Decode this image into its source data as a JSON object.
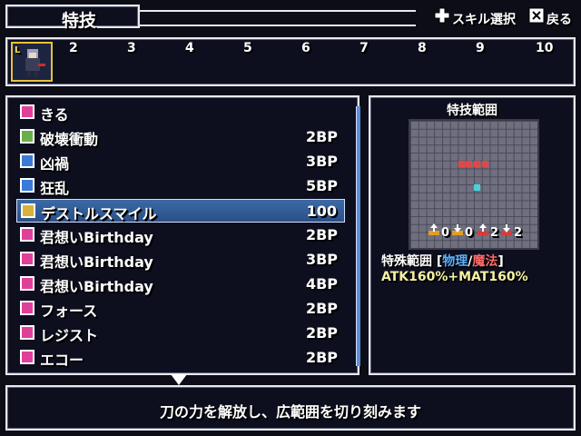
{
  "header": {
    "title": "特技",
    "hint_skill": "スキル選択",
    "hint_back": "戻る"
  },
  "party": {
    "slots": [
      "2",
      "3",
      "4",
      "5",
      "6",
      "7",
      "8",
      "9",
      "10"
    ],
    "leader_mark": "L"
  },
  "skills": [
    {
      "name": "きる",
      "cost": "",
      "icon": "pink-sword-icon",
      "color": "#e0409a"
    },
    {
      "name": "破壊衝動",
      "cost": "2BP",
      "icon": "green-plus-icon",
      "color": "#6ab04a"
    },
    {
      "name": "凶禍",
      "cost": "3BP",
      "icon": "square-icon",
      "color": "#3a7ad8"
    },
    {
      "name": "狂乱",
      "cost": "5BP",
      "icon": "square-icon",
      "color": "#3a7ad8"
    },
    {
      "name": "デストルスマイル",
      "cost": "100",
      "icon": "yellow-gear-icon",
      "color": "#d6b23a",
      "selected": true
    },
    {
      "name": "君想いBirthday",
      "cost": "2BP",
      "icon": "music-note-icon",
      "color": "#e0409a"
    },
    {
      "name": "君想いBirthday",
      "cost": "3BP",
      "icon": "music-note-plus-icon",
      "color": "#e0409a"
    },
    {
      "name": "君想いBirthday",
      "cost": "4BP",
      "icon": "music-note-plus2-icon",
      "color": "#e0409a"
    },
    {
      "name": "フォース",
      "cost": "2BP",
      "icon": "vo-icon",
      "color": "#e0409a"
    },
    {
      "name": "レジスト",
      "cost": "2BP",
      "icon": "vo-icon",
      "color": "#e0409a"
    },
    {
      "name": "エコー",
      "cost": "2BP",
      "icon": "vo-icon",
      "color": "#e0409a"
    }
  ],
  "range": {
    "title": "特技範囲",
    "stats": [
      "0",
      "0",
      "2",
      "2"
    ],
    "special_label": "特殊範囲",
    "type_physical": "物理",
    "type_magic": "魔法",
    "formula": "ATK160%+MAT160%"
  },
  "description": "刀の力を解放し、広範囲を切り刻みます",
  "colors": {
    "accent_physical": "#5fb0ff",
    "accent_magic": "#ff6a6a",
    "selection": "#3b6aa6"
  }
}
